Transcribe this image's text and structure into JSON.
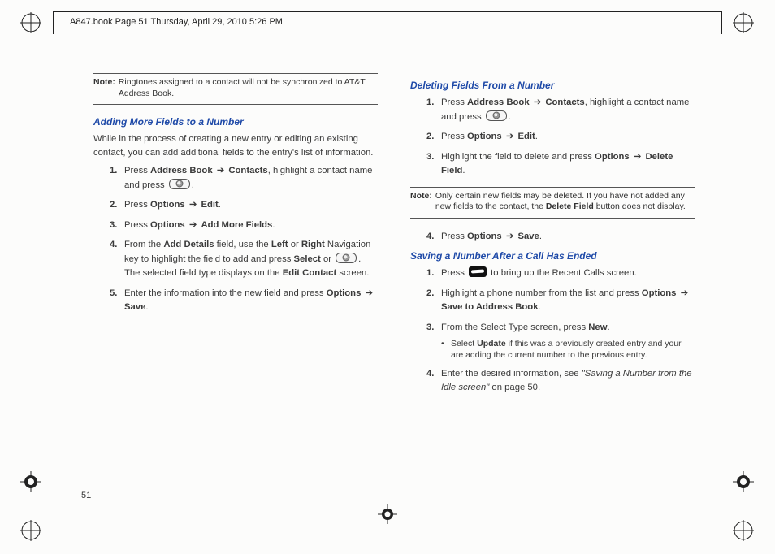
{
  "crop_header": "A847.book  Page 51  Thursday, April 29, 2010  5:26 PM",
  "page_number": "51",
  "left": {
    "note1": {
      "label": "Note:",
      "body": "Ringtones assigned to a contact will not be synchronized to AT&T Address Book."
    },
    "heading1": "Adding More Fields to a Number",
    "intro": "While in the process of creating a new entry or editing an existing contact, you can add additional fields to the entry's list of information.",
    "step1": {
      "num": "1.",
      "a": "Press ",
      "b": "Address Book",
      "arr": " ➔ ",
      "c": "Contacts",
      "d": ", highlight a contact name and press ",
      "e": "."
    },
    "step2": {
      "num": "2.",
      "a": "Press ",
      "b": "Options",
      "arr": " ➔ ",
      "c": "Edit",
      "d": "."
    },
    "step3": {
      "num": "3.",
      "a": "Press ",
      "b": "Options",
      "arr": " ➔ ",
      "c": "Add More Fields",
      "d": "."
    },
    "step4": {
      "num": "4.",
      "a": "From the ",
      "b": "Add Details",
      "c": " field, use the ",
      "d": "Left",
      "e": " or ",
      "f": "Right",
      "g": " Navigation key to highlight the field to add and press ",
      "h": "Select",
      "i": " or ",
      "j": ". The selected field type displays on the ",
      "k": "Edit Contact",
      "l": " screen."
    },
    "step5": {
      "num": "5.",
      "a": "Enter the information into the new field and press ",
      "b": "Options",
      "arr": " ➔ ",
      "c": "Save",
      "d": "."
    }
  },
  "right": {
    "heading1": "Deleting Fields From a Number",
    "d_step1": {
      "num": "1.",
      "a": "Press ",
      "b": "Address Book",
      "arr": " ➔ ",
      "c": "Contacts",
      "d": ", highlight a contact name and press ",
      "e": "."
    },
    "d_step2": {
      "num": "2.",
      "a": "Press ",
      "b": "Options",
      "arr": " ➔ ",
      "c": "Edit",
      "d": "."
    },
    "d_step3": {
      "num": "3.",
      "a": "Highlight the field to delete and press ",
      "b": "Options",
      "arr": " ➔ ",
      "c": "Delete Field",
      "d": "."
    },
    "note2": {
      "label": "Note:",
      "body_a": "Only certain new fields may be deleted. If you have not added any new fields to the contact, the ",
      "body_b": "Delete Field",
      "body_c": " button does not display."
    },
    "d_step4": {
      "num": "4.",
      "a": "Press ",
      "b": "Options",
      "arr": " ➔ ",
      "c": "Save",
      "d": "."
    },
    "heading2": "Saving a Number After a Call Has Ended",
    "s_step1": {
      "num": "1.",
      "a": "Press ",
      "b": " to bring up the Recent Calls screen."
    },
    "s_step2": {
      "num": "2.",
      "a": "Highlight a phone number from the list and press ",
      "b": "Options",
      "arr": " ➔ ",
      "c": "Save to Address Book",
      "d": "."
    },
    "s_step3": {
      "num": "3.",
      "a": "From the Select Type screen, press ",
      "b": "New",
      "c": "."
    },
    "s_sub": {
      "a": "Select ",
      "b": "Update",
      "c": " if this was a previously created entry and your are adding the current number to the previous entry."
    },
    "s_step4": {
      "num": "4.",
      "a": "Enter the desired information, see ",
      "b": "\"Saving a Number from the Idle screen\"",
      "c": " on page 50."
    }
  }
}
